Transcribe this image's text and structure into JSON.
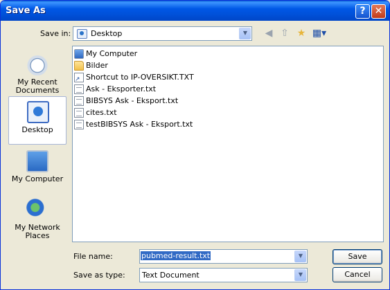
{
  "window": {
    "title": "Save As",
    "help": "?",
    "close": "✕"
  },
  "save_in": {
    "label": "Save in:",
    "value": "Desktop"
  },
  "toolbar": {
    "back": "◀",
    "up": "⇧",
    "new_folder": "★",
    "views": "▦▾"
  },
  "places": [
    {
      "label": "My Recent Documents"
    },
    {
      "label": "Desktop"
    },
    {
      "label": "My Computer"
    },
    {
      "label": "My Network Places"
    }
  ],
  "files": [
    {
      "name": "My Computer",
      "icon": "computer-icon"
    },
    {
      "name": "Bilder",
      "icon": "folder-icon"
    },
    {
      "name": "Shortcut to IP-OVERSIKT.TXT",
      "icon": "shortcut-icon"
    },
    {
      "name": "Ask - Eksporter.txt",
      "icon": "text-file-icon"
    },
    {
      "name": "BIBSYS Ask - Eksport.txt",
      "icon": "text-file-icon"
    },
    {
      "name": "cites.txt",
      "icon": "text-file-icon"
    },
    {
      "name": "testBIBSYS Ask - Eksport.txt",
      "icon": "text-file-icon"
    }
  ],
  "file_name": {
    "label": "File name:",
    "value": "pubmed-result.txt"
  },
  "save_as_type": {
    "label": "Save as type:",
    "value": "Text Document"
  },
  "buttons": {
    "save": "Save",
    "cancel": "Cancel"
  },
  "colors": {
    "title_bar": "#0058E6",
    "places_bar": "#7A96DF",
    "dialog_bg": "#ECE9D8",
    "selection": "#316AC5"
  }
}
